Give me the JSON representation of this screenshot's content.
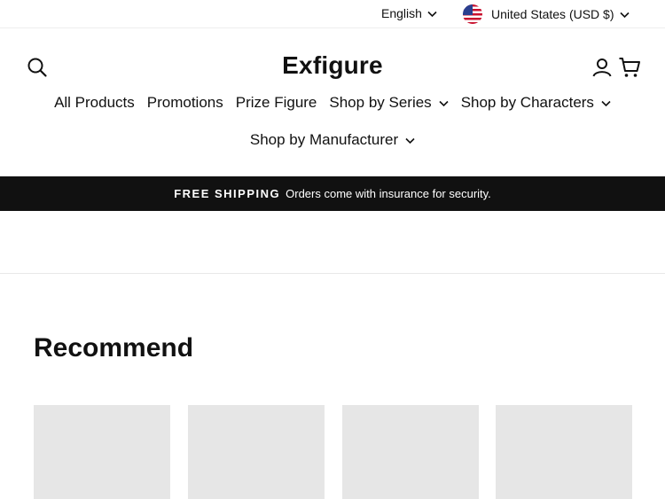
{
  "topbar": {
    "language": "English",
    "currency": "United States (USD $)",
    "flag_icon": "us-flag-icon"
  },
  "header": {
    "logo": "Exfigure",
    "icons": [
      "search-icon",
      "account-icon",
      "cart-icon"
    ]
  },
  "nav": {
    "row1": [
      {
        "label": "All Products",
        "has_dropdown": false
      },
      {
        "label": "Promotions",
        "has_dropdown": false
      },
      {
        "label": "Prize Figure",
        "has_dropdown": false
      },
      {
        "label": "Shop by Series",
        "has_dropdown": true
      },
      {
        "label": "Shop by Characters",
        "has_dropdown": true
      }
    ],
    "row2": [
      {
        "label": "Shop by Manufacturer",
        "has_dropdown": true
      }
    ]
  },
  "promo": {
    "strong": "FREE SHIPPING",
    "text": "Orders come with insurance for security."
  },
  "recommend": {
    "title": "Recommend",
    "placeholder_count": 4
  },
  "colors": {
    "promo_bg": "#111111",
    "placeholder": "#e6e6e6",
    "text": "#111111"
  }
}
